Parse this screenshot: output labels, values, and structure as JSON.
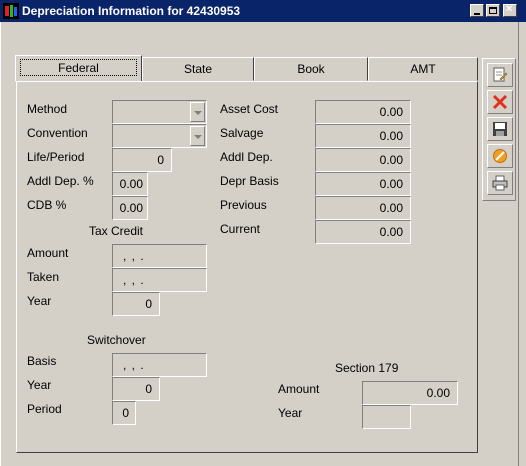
{
  "window": {
    "title": "Depreciation Information for 42430953"
  },
  "tabs": [
    {
      "label": "Federal",
      "active": true
    },
    {
      "label": "State",
      "active": false
    },
    {
      "label": "Book",
      "active": false
    },
    {
      "label": "AMT",
      "active": false
    }
  ],
  "left": {
    "method": {
      "label": "Method",
      "value": ""
    },
    "convention": {
      "label": "Convention",
      "value": ""
    },
    "life_period": {
      "label": "Life/Period",
      "value": "0"
    },
    "addl_dep_pct": {
      "label": "Addl Dep. %",
      "value": "0.00"
    },
    "cdb_pct": {
      "label": "CDB %",
      "value": "0.00"
    }
  },
  "tax_credit": {
    "heading": "Tax Credit",
    "amount": {
      "label": "Amount",
      "value": ",  ,  ."
    },
    "taken": {
      "label": "Taken",
      "value": ",  ,  ."
    },
    "year": {
      "label": "Year",
      "value": "0"
    }
  },
  "switchover": {
    "heading": "Switchover",
    "basis": {
      "label": "Basis",
      "value": ",  ,  ."
    },
    "year": {
      "label": "Year",
      "value": "0"
    },
    "period": {
      "label": "Period",
      "value": "0"
    }
  },
  "right": {
    "asset_cost": {
      "label": "Asset Cost",
      "value": "0.00"
    },
    "salvage": {
      "label": "Salvage",
      "value": "0.00"
    },
    "addl_dep": {
      "label": "Addl Dep.",
      "value": "0.00"
    },
    "depr_basis": {
      "label": "Depr Basis",
      "value": "0.00"
    },
    "previous": {
      "label": "Previous",
      "value": "0.00"
    },
    "current": {
      "label": "Current",
      "value": "0.00"
    }
  },
  "section179": {
    "heading": "Section 179",
    "amount": {
      "label": "Amount",
      "value": "0.00"
    },
    "year": {
      "label": "Year",
      "value": ""
    }
  },
  "toolbar": {
    "icons": [
      "edit-icon",
      "delete-icon",
      "save-icon",
      "cancel-icon",
      "print-icon"
    ]
  },
  "colors": {
    "titlebar": "#0a246a",
    "face": "#d4d0c8",
    "delete_red": "#e03020",
    "cancel_orange": "#f0a020"
  }
}
